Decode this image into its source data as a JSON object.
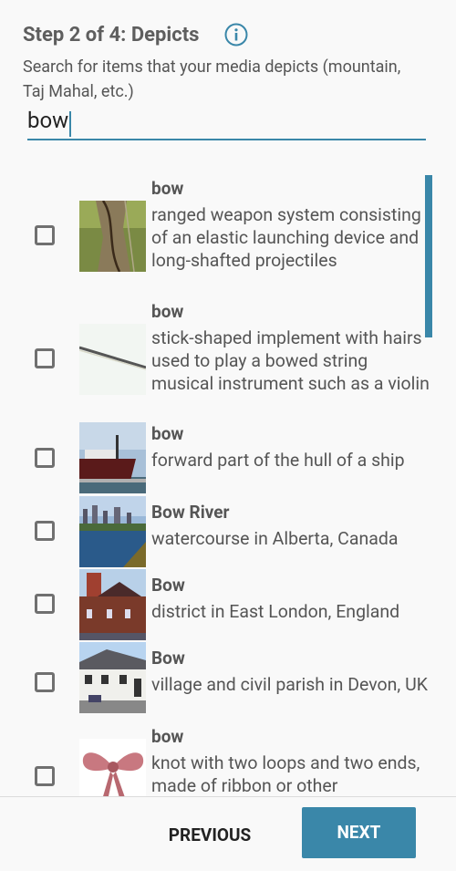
{
  "header": {
    "title": "Step 2 of 4: Depicts",
    "subtitle": "Search for items that your media depicts (mountain, Taj Mahal, etc.)"
  },
  "search": {
    "value": "bow"
  },
  "colors": {
    "accent": "#3a87a9"
  },
  "icons": {
    "info": "info-icon",
    "checkbox": "checkbox-unchecked"
  },
  "results": [
    {
      "label": "bow",
      "description": "ranged weapon system consisting of an elastic launching device and long-shafted projectiles",
      "checked": false
    },
    {
      "label": "bow",
      "description": "stick-shaped implement with hairs used to play a bowed string musical instrument such as a violin",
      "checked": false
    },
    {
      "label": "bow",
      "description": "forward part of the hull of a ship",
      "checked": false
    },
    {
      "label": "Bow River",
      "description": "watercourse in Alberta, Canada",
      "checked": false
    },
    {
      "label": "Bow",
      "description": "district in East London, England",
      "checked": false
    },
    {
      "label": "Bow",
      "description": "village and civil parish in Devon, UK",
      "checked": false
    },
    {
      "label": "bow",
      "description": "knot with two loops and two ends, made of ribbon or other",
      "checked": false
    }
  ],
  "footer": {
    "previous_label": "PREVIOUS",
    "next_label": "NEXT"
  }
}
